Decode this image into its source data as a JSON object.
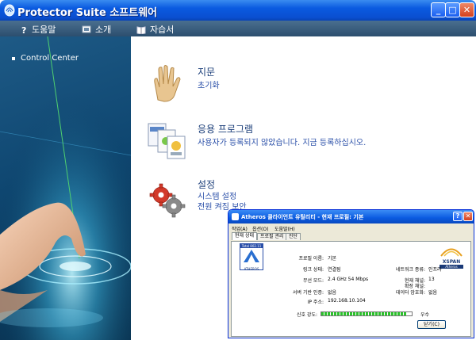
{
  "window": {
    "title": "Protector Suite 소프트웨어",
    "controls": {
      "minimize": "_",
      "maximize": "□",
      "close": "✕"
    }
  },
  "menu": [
    {
      "label": "도움말",
      "icon": "help-icon"
    },
    {
      "label": "소개",
      "icon": "about-icon"
    },
    {
      "label": "자습서",
      "icon": "book-icon"
    }
  ],
  "sidebar": {
    "items": [
      {
        "label": "Control Center"
      }
    ]
  },
  "main": {
    "sections": [
      {
        "title": "지문",
        "links": [
          "초기화"
        ],
        "icon": "hand-icon"
      },
      {
        "title": "응용 프로그램",
        "links": [
          "사용자가 등록되지 않았습니다. 지금 등록하십시오."
        ],
        "icon": "applications-icon"
      },
      {
        "title": "설정",
        "links": [
          "시스템 설정",
          "전원 켜짐 보안"
        ],
        "icon": "gears-icon"
      }
    ]
  },
  "dialog": {
    "title": "Atheros 클라이언트 유틸리티 - 현재 프로필: 기본",
    "controls": {
      "help": "?",
      "close": "✕"
    },
    "menu": [
      "작업(A)",
      "옵션(O)",
      "도움말(H)"
    ],
    "tabs": [
      "현재 상태",
      "프로필 관리",
      "진단"
    ],
    "active_tab": "현재 상태",
    "logo_left_top": "Total 802.11",
    "logo_left_bottom": "ATHEROS",
    "logo_right_top": "XSPAN",
    "logo_right_bottom": "Atheros",
    "fields": [
      {
        "label": "프로필 이름:",
        "value": "기본"
      },
      {
        "label": "링크 상태:",
        "value": "연결됨"
      },
      {
        "label": "무선 모드:",
        "value": "2.4 GHz 54 Mbps"
      },
      {
        "label": "서버 기반 인증:",
        "value": "없음"
      },
      {
        "label": "IP 주소:",
        "value": "192.168.10.104"
      }
    ],
    "right_fields": [
      {
        "label": "네트워크 종류:",
        "value": "인프라"
      },
      {
        "label": "현재 채널:",
        "value": "13"
      },
      {
        "label": "확장 채널:",
        "value": ""
      },
      {
        "label": "데이터 암호화:",
        "value": "없음"
      }
    ],
    "signal": {
      "label": "신호 강도:",
      "value_text": "우수",
      "level": 0.95
    },
    "close_button": "닫기(C)"
  },
  "colors": {
    "titlebar": "#0a5ae0",
    "menubar": "#2c4e6e",
    "sidebar": "#0e4670",
    "link": "#2a4fa8",
    "signal": "#2bc42b"
  }
}
